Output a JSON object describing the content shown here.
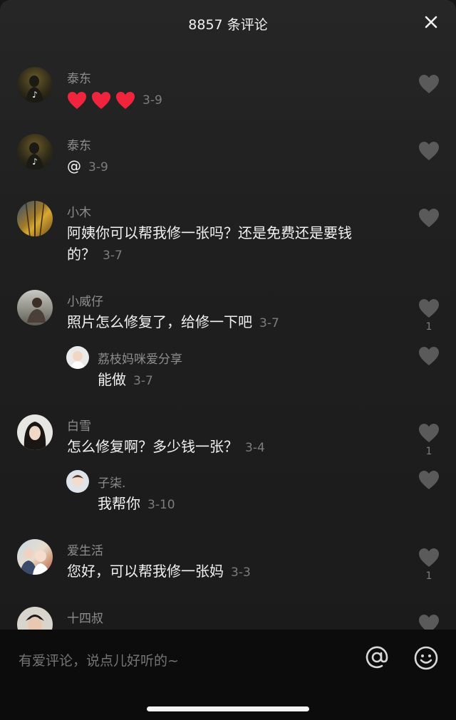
{
  "header": {
    "title": "8857 条评论"
  },
  "comments": [
    {
      "name": "泰东",
      "text": "",
      "emoji_count": 3,
      "date": "3-9",
      "likes": ""
    },
    {
      "name": "泰东",
      "text": "@",
      "date": "3-9",
      "likes": ""
    },
    {
      "name": "小木",
      "line1": "阿姨你可以帮我修一张吗？还是免费还是要钱",
      "line2": "的？",
      "date": "3-7",
      "likes": ""
    },
    {
      "name": "小威仔",
      "text": "照片怎么修复了，给修一下吧",
      "date": "3-7",
      "likes": "1"
    },
    {
      "name": "荔枝妈咪爱分享",
      "text": "能做",
      "date": "3-7",
      "likes": ""
    },
    {
      "name": "白雪",
      "text": "怎么修复啊？多少钱一张？",
      "date": "3-4",
      "likes": "1"
    },
    {
      "name": "子柒.",
      "text": "我帮你",
      "date": "3-10",
      "likes": ""
    },
    {
      "name": "爱生活",
      "text": "您好，可以帮我修一张妈",
      "date": "3-3",
      "likes": "1"
    },
    {
      "name": "十四叔",
      "text": "",
      "date": "",
      "likes": ""
    }
  ],
  "input": {
    "placeholder": "有爱评论，说点儿好听的~"
  },
  "icons": {
    "close": "close-icon",
    "like": "heart-icon",
    "at": "at-icon",
    "emoji": "emoji-icon"
  },
  "colors": {
    "heart_red": "#f0243c",
    "like_gray": "#5a5a5a"
  }
}
